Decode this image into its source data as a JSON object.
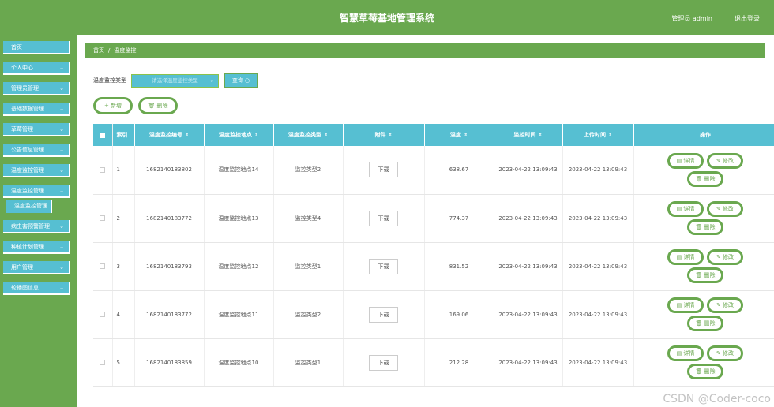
{
  "header": {
    "title": "智慧草莓基地管理系统",
    "user": "管理员 admin",
    "logout": "退出登录"
  },
  "sidebar": {
    "items": [
      {
        "label": "首页",
        "chevron": ""
      },
      {
        "label": "个人中心",
        "chevron": "⌄"
      },
      {
        "label": "管理员管理",
        "chevron": "⌄"
      },
      {
        "label": "基础数据管理",
        "chevron": "⌄"
      },
      {
        "label": "草莓管理",
        "chevron": "⌄"
      },
      {
        "label": "公告信息管理",
        "chevron": "⌄"
      },
      {
        "label": "温度监控管理",
        "chevron": "⌄"
      },
      {
        "label": "温度监控管理",
        "chevron": "⌄"
      },
      {
        "label": "温度监控管理",
        "chevron": ""
      },
      {
        "label": "病虫害预警管理",
        "chevron": "⌄"
      },
      {
        "label": "种植计划管理",
        "chevron": "⌄"
      },
      {
        "label": "用户管理",
        "chevron": "⌄"
      },
      {
        "label": "轮播图信息",
        "chevron": "⌄"
      }
    ]
  },
  "breadcrumb": {
    "home": "首页",
    "sep": "/",
    "current": "温度监控"
  },
  "search": {
    "label": "温度监控类型",
    "placeholder": "请选择温度监控类型",
    "button": "查询 ○"
  },
  "actions": {
    "add": "+ 新增",
    "delete": "🗑 删除"
  },
  "table": {
    "headers": [
      "索引",
      "温度监控编号",
      "温度监控地点",
      "温度监控类型",
      "附件",
      "温度",
      "监控时间",
      "上传时间",
      "操作"
    ],
    "sort_icon": "⇕",
    "download": "下载",
    "ops": {
      "detail": "▤ 详情",
      "edit": "✎ 修改",
      "delete": "🗑 删除"
    },
    "rows": [
      {
        "index": "1",
        "code": "1682140183802",
        "place": "温度监控地点14",
        "type": "监控类型2",
        "temp": "638.67",
        "monitor_time": "2023-04-22 13:09:43",
        "upload_time": "2023-04-22 13:09:43"
      },
      {
        "index": "2",
        "code": "1682140183772",
        "place": "温度监控地点13",
        "type": "监控类型4",
        "temp": "774.37",
        "monitor_time": "2023-04-22 13:09:43",
        "upload_time": "2023-04-22 13:09:43"
      },
      {
        "index": "3",
        "code": "1682140183793",
        "place": "温度监控地点12",
        "type": "监控类型1",
        "temp": "831.52",
        "monitor_time": "2023-04-22 13:09:43",
        "upload_time": "2023-04-22 13:09:43"
      },
      {
        "index": "4",
        "code": "1682140183772",
        "place": "温度监控地点11",
        "type": "监控类型2",
        "temp": "169.06",
        "monitor_time": "2023-04-22 13:09:43",
        "upload_time": "2023-04-22 13:09:43"
      },
      {
        "index": "5",
        "code": "1682140183859",
        "place": "温度监控地点10",
        "type": "监控类型1",
        "temp": "212.28",
        "monitor_time": "2023-04-22 13:09:43",
        "upload_time": "2023-04-22 13:09:43"
      }
    ]
  },
  "watermark": "CSDN @Coder-coco"
}
